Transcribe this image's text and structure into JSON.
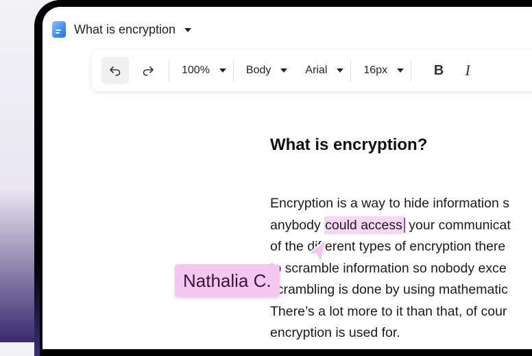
{
  "document": {
    "title": "What is encryption",
    "heading": "What is encryption?",
    "body_lines": [
      {
        "before": "Encryption is a way to hide information s",
        "highlight": "",
        "after": ""
      },
      {
        "before": "anybody ",
        "highlight": "could access",
        "after": " your communicat"
      },
      {
        "before": "of the different types of encryption there",
        "highlight": "",
        "after": ""
      },
      {
        "before": "to scramble information so nobody exce",
        "highlight": "",
        "after": ""
      },
      {
        "before": "scrambling is done by using mathematic",
        "highlight": "",
        "after": ""
      },
      {
        "before": "There’s a lot more to it than that, of cour",
        "highlight": "",
        "after": ""
      },
      {
        "before": "encryption is used for.",
        "highlight": "",
        "after": ""
      }
    ]
  },
  "toolbar": {
    "zoom": "100%",
    "style": "Body",
    "font": "Arial",
    "size": "16px",
    "bold_label": "B",
    "italic_label": "I"
  },
  "collaborator": {
    "name": "Nathalia C.",
    "color": "#f3c7ef"
  },
  "icons": {
    "app": "docs-app-icon",
    "undo": "undo-icon",
    "redo": "redo-icon",
    "dropdown": "chevron-down-icon",
    "cursor": "collaborator-cursor-icon"
  }
}
